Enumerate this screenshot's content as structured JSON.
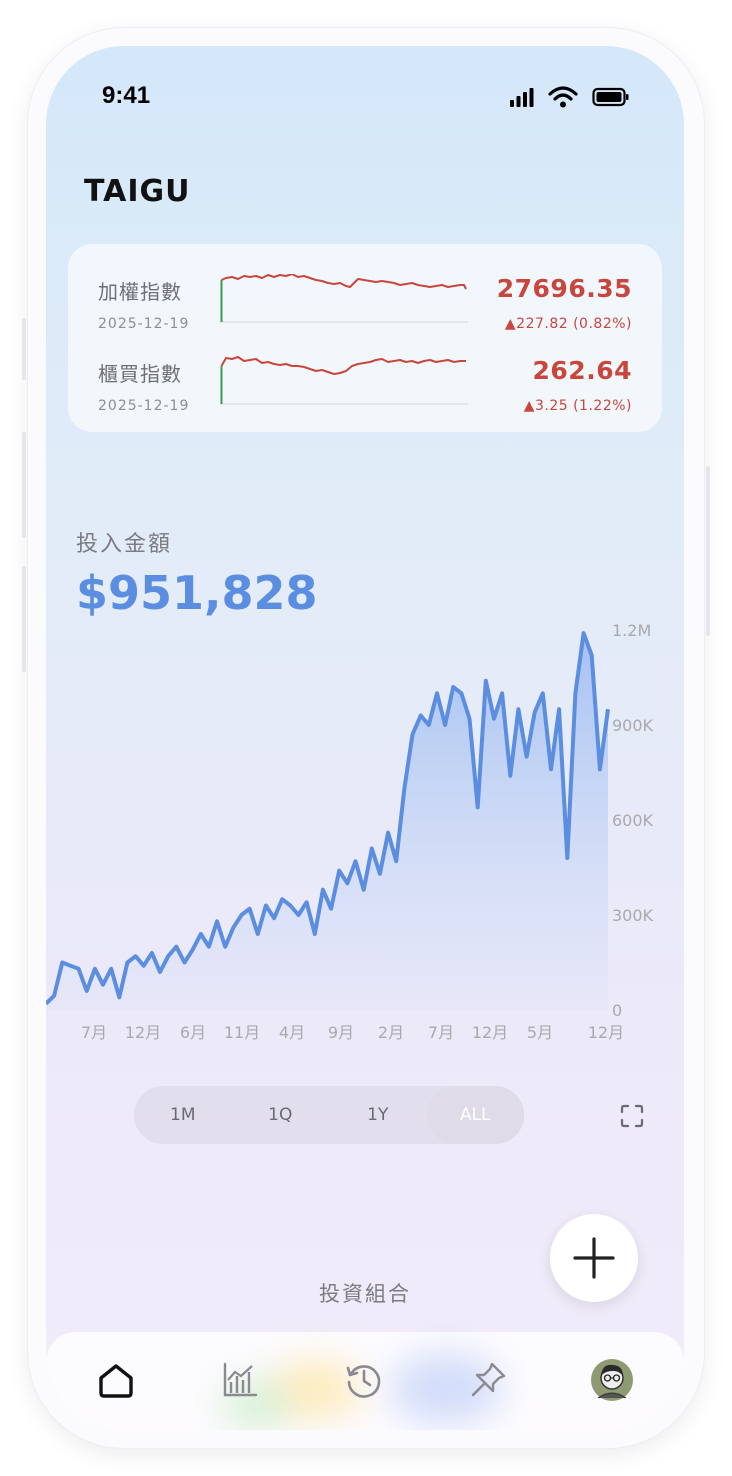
{
  "status_bar": {
    "time": "9:41"
  },
  "app": {
    "brand": "TAIGU"
  },
  "indices": [
    {
      "name": "加權指數",
      "date": "2025-12-19",
      "value": "27696.35",
      "change": "▲227.82 (0.82%)"
    },
    {
      "name": "櫃買指數",
      "date": "2025-12-19",
      "value": "262.64",
      "change": "▲3.25 (1.22%)"
    }
  ],
  "investment": {
    "label": "投入金額",
    "amount": "$951,828"
  },
  "chart_data": {
    "type": "area",
    "x_ticks": [
      "7月",
      "12月",
      "6月",
      "11月",
      "4月",
      "9月",
      "2月",
      "7月",
      "12月",
      "5月",
      "12月"
    ],
    "y_ticks": [
      "1.2M",
      "900K",
      "600K",
      "300K",
      "0"
    ],
    "ylim": [
      0,
      1200000
    ],
    "series": [
      {
        "values": [
          20000,
          45000,
          150000,
          140000,
          130000,
          60000,
          130000,
          80000,
          130000,
          40000,
          150000,
          170000,
          140000,
          180000,
          120000,
          170000,
          200000,
          150000,
          190000,
          240000,
          200000,
          280000,
          200000,
          260000,
          300000,
          320000,
          240000,
          330000,
          290000,
          350000,
          330000,
          300000,
          340000,
          240000,
          380000,
          320000,
          440000,
          400000,
          470000,
          380000,
          510000,
          430000,
          560000,
          470000,
          700000,
          870000,
          930000,
          900000,
          1000000,
          900000,
          1020000,
          1000000,
          920000,
          640000,
          1040000,
          920000,
          1000000,
          740000,
          950000,
          800000,
          940000,
          1000000,
          760000,
          950000,
          480000,
          1000000,
          1190000,
          1120000,
          760000,
          950000
        ]
      }
    ],
    "line_color": "#5b8ee0"
  },
  "range_selector": {
    "options": [
      "1M",
      "1Q",
      "1Y",
      "ALL"
    ],
    "selected": "ALL"
  },
  "portfolio": {
    "label": "投資組合"
  },
  "tabs": [
    {
      "icon": "home-icon",
      "active": true
    },
    {
      "icon": "bar-chart-icon"
    },
    {
      "icon": "history-icon"
    },
    {
      "icon": "pin-icon"
    },
    {
      "icon": "avatar"
    }
  ]
}
